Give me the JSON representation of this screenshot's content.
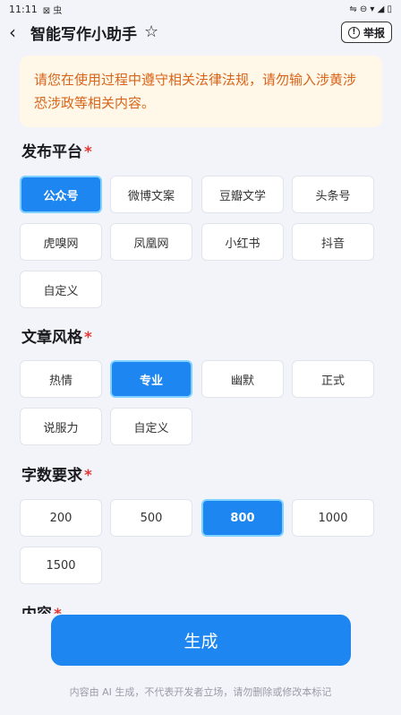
{
  "status": {
    "time": "11:11",
    "left_icons": "⊠ 虫",
    "right_icons": "⇋ ⊖ ▾ ◢ ▯"
  },
  "header": {
    "title": "智能写作小助手",
    "star": "☆",
    "report_label": "举报",
    "back": "‹",
    "info": "!"
  },
  "notice": {
    "text": "请您在使用过程中遵守相关法律法规，请勿输入涉黄涉恐涉政等相关内容。"
  },
  "platform": {
    "title": "发布平台",
    "required": "*",
    "options": [
      "公众号",
      "微博文案",
      "豆瓣文学",
      "头条号",
      "虎嗅网",
      "凤凰网",
      "小红书",
      "抖音",
      "自定义"
    ],
    "selected": "公众号"
  },
  "style": {
    "title": "文章风格",
    "required": "*",
    "options": [
      "热情",
      "专业",
      "幽默",
      "正式",
      "说服力",
      "自定义"
    ],
    "selected": "专业"
  },
  "word_count": {
    "title": "字数要求",
    "required": "*",
    "options": [
      "200",
      "500",
      "800",
      "1000",
      "1500"
    ],
    "selected": "800"
  },
  "content": {
    "title": "内容",
    "required": "*"
  },
  "generate": {
    "label": "生成"
  },
  "footer": {
    "disclaimer": "内容由 AI 生成，不代表开发者立场，请勿删除或修改本标记"
  },
  "colors": {
    "accent": "#1e86f0",
    "notice_bg": "#fff7e7",
    "notice_text": "#d9641a",
    "required": "#e53935"
  }
}
